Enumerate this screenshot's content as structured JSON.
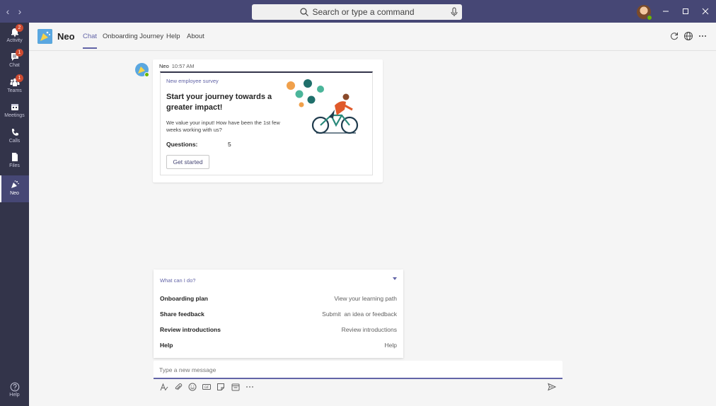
{
  "titlebar": {
    "search_placeholder": "Search or type a command",
    "colors": {
      "bar": "#464775"
    }
  },
  "rail": {
    "items": [
      {
        "label": "Activity",
        "badge": "2",
        "icon": "bell-icon"
      },
      {
        "label": "Chat",
        "badge": "1",
        "icon": "chat-icon"
      },
      {
        "label": "Teams",
        "badge": "1",
        "icon": "teams-icon"
      },
      {
        "label": "Meetings",
        "badge": "",
        "icon": "calendar-icon"
      },
      {
        "label": "Calls",
        "badge": "",
        "icon": "phone-icon"
      },
      {
        "label": "Files",
        "badge": "",
        "icon": "file-icon"
      },
      {
        "label": "Neo",
        "badge": "",
        "icon": "neo-icon",
        "active": true
      }
    ],
    "help_label": "Help"
  },
  "header": {
    "app_name": "Neo",
    "tabs": [
      {
        "label": "Chat",
        "active": true
      },
      {
        "label": "Onboarding Journey"
      },
      {
        "label": "Help"
      },
      {
        "label": "About"
      }
    ]
  },
  "message": {
    "sender": "Neo",
    "time": "10:57 AM",
    "card": {
      "kicker": "New employee survey",
      "title": "Start your journey towards a greater impact!",
      "body": "We value your input! How have been the 1st few weeks working with us?",
      "questions_label": "Questions:",
      "questions_value": "5",
      "button_label": "Get started"
    }
  },
  "commands": {
    "heading": "What can I do?",
    "items": [
      {
        "name": "Onboarding plan",
        "desc": "View your learning path"
      },
      {
        "name": "Share feedback",
        "desc": "Submit  an idea or feedback"
      },
      {
        "name": "Review introductions",
        "desc": "Review introductions"
      },
      {
        "name": "Help",
        "desc": "Help"
      }
    ]
  },
  "compose": {
    "placeholder": "Type a new message"
  },
  "accent": "#6264a7"
}
